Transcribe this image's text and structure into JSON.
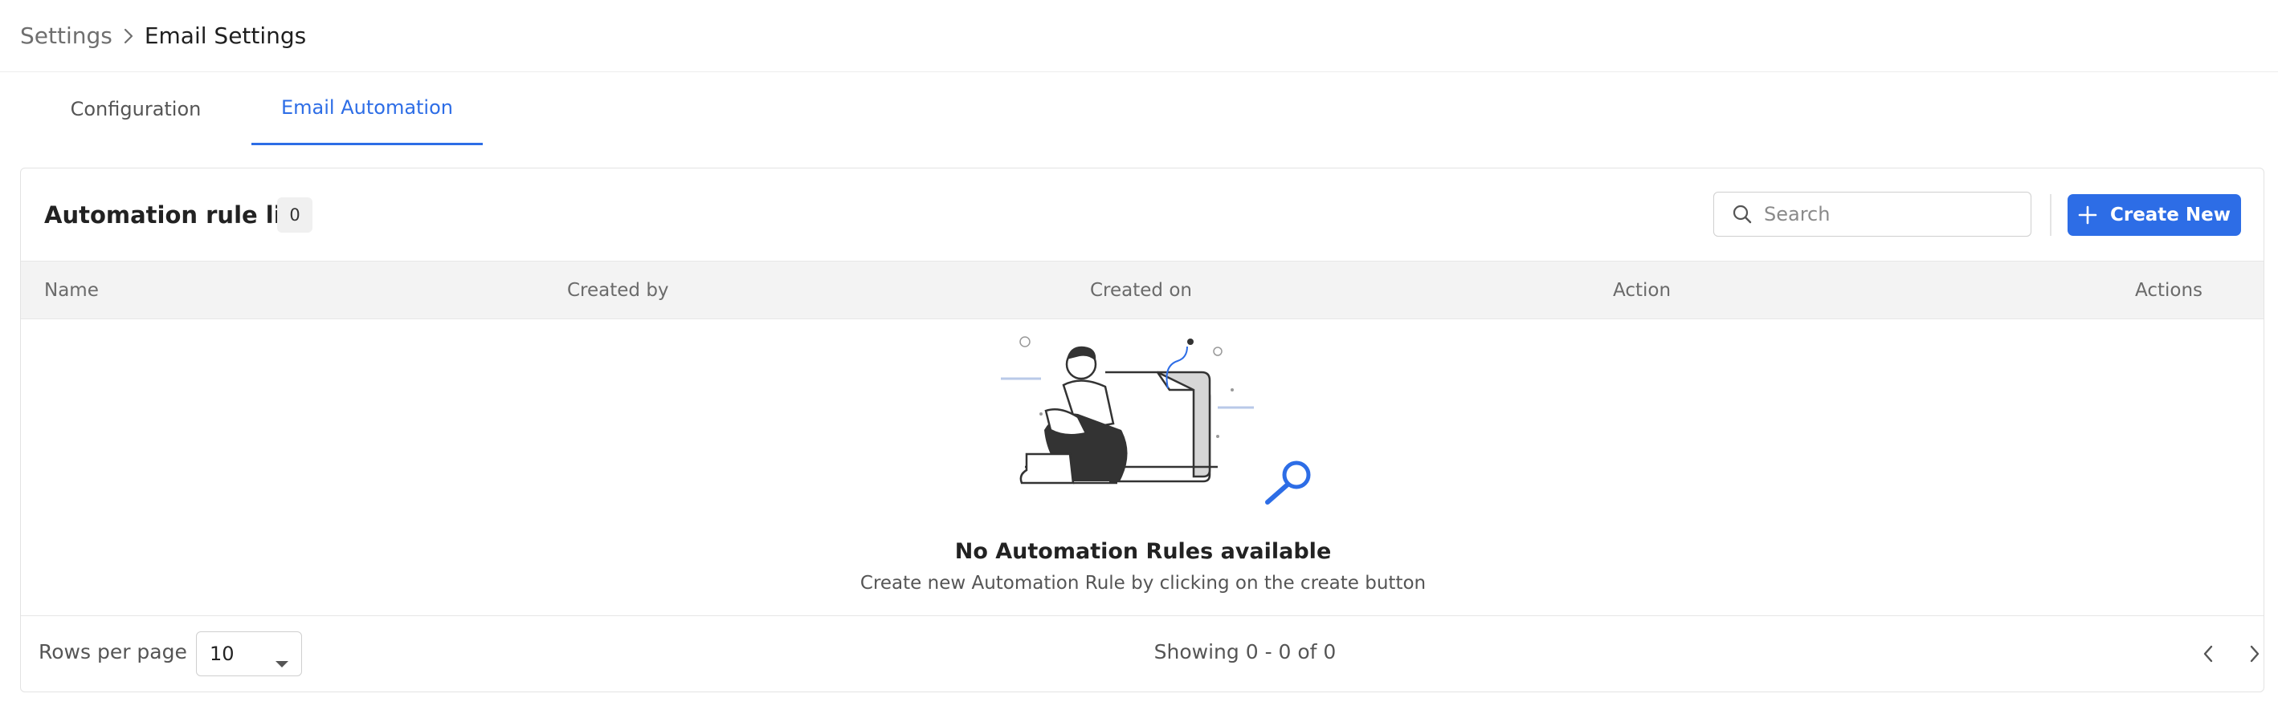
{
  "breadcrumb": {
    "root": "Settings",
    "current": "Email Settings"
  },
  "tabs": [
    {
      "label": "Configuration",
      "active": false
    },
    {
      "label": "Email Automation",
      "active": true
    }
  ],
  "list": {
    "title": "Automation rule list",
    "count": "0",
    "search_placeholder": "Search",
    "create_label": "Create New",
    "columns": [
      "Name",
      "Created by",
      "Created on",
      "Action",
      "Actions"
    ]
  },
  "empty_state": {
    "title": "No Automation Rules available",
    "subtitle": "Create new Automation Rule by clicking on the create button"
  },
  "footer": {
    "rows_per_page_label": "Rows per page",
    "rows_per_page_value": "10",
    "showing": "Showing 0 - 0 of 0"
  },
  "colors": {
    "accent": "#2d6de6",
    "header_bg": "#f3f3f3",
    "border": "#e3e3e3"
  },
  "icons": [
    "chevron-right-icon",
    "search-icon",
    "plus-icon",
    "caret-down-icon",
    "chevron-left-icon",
    "empty-state-illustration"
  ]
}
